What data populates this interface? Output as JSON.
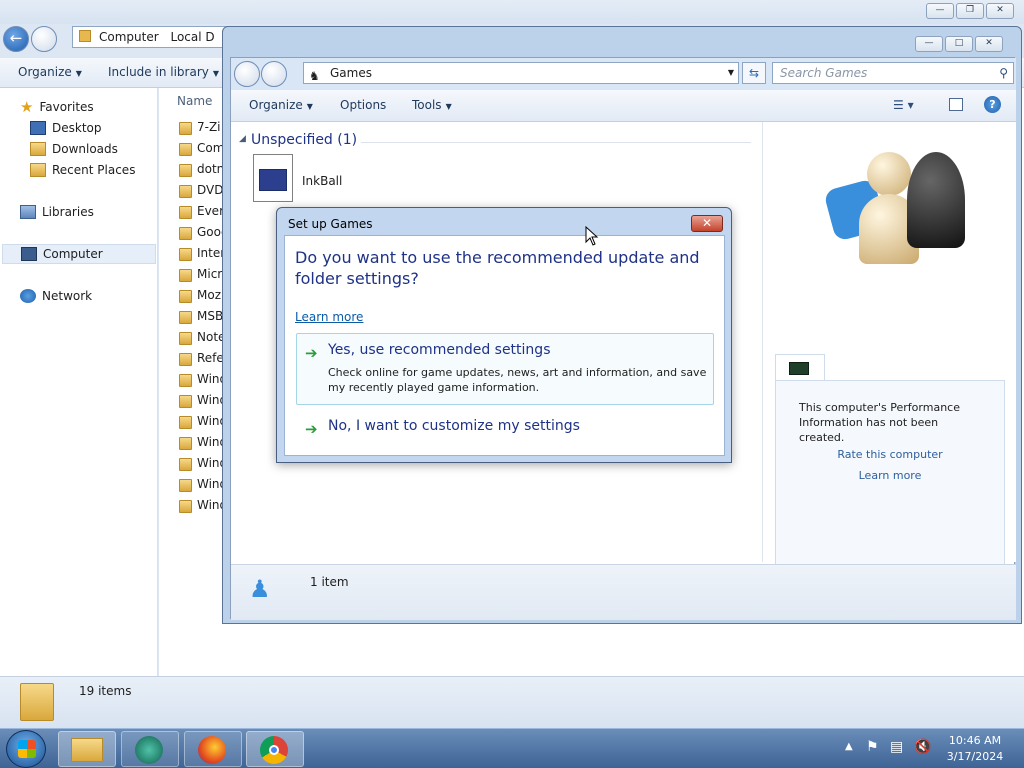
{
  "back_explorer": {
    "address": [
      "Computer",
      "Local D"
    ],
    "commands": {
      "organize": "Organize",
      "include_in_library": "Include in library"
    },
    "nav": {
      "favorites": "Favorites",
      "desktop": "Desktop",
      "downloads": "Downloads",
      "recent_places": "Recent Places",
      "libraries": "Libraries",
      "computer": "Computer",
      "network": "Network"
    },
    "column_name": "Name",
    "folders": [
      "7-Zi",
      "Com",
      "dotn",
      "DVD",
      "Every",
      "Goog",
      "Inter",
      "Micr",
      "Moz",
      "MSB",
      "Note",
      "Refe",
      "Wind",
      "Wind",
      "Wind",
      "Wind",
      "Wind",
      "Wind",
      "Wind"
    ],
    "status_count": "19 items"
  },
  "games_window": {
    "address": "Games",
    "search_placeholder": "Search Games",
    "commands": {
      "organize": "Organize",
      "options": "Options",
      "tools": "Tools"
    },
    "group_header": "Unspecified (1)",
    "item_label": "InkBall",
    "perf_text": "This computer's Performance Information has not been created.",
    "rate_link": "Rate this computer",
    "learn_link": "Learn more",
    "status_count": "1 item"
  },
  "dialog": {
    "title": "Set up Games",
    "question": "Do you want to use the recommended update and folder settings?",
    "learn_more": "Learn more",
    "option1_title": "Yes, use recommended settings",
    "option1_sub": "Check online for game updates, news, art and information, and save my recently played game information.",
    "option2_title": "No, I want to customize my settings"
  },
  "taskbar": {
    "time": "10:46 AM",
    "date": "3/17/2024"
  }
}
